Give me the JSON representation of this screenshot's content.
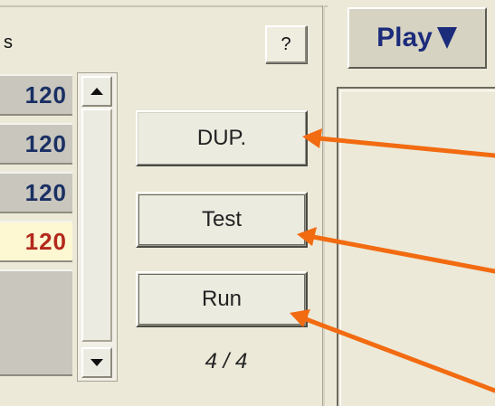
{
  "left_panel": {
    "header_text": "s",
    "help_label": "?",
    "list_rows": [
      {
        "text": "120",
        "selected": false
      },
      {
        "text": "120",
        "selected": false
      },
      {
        "text": "120",
        "selected": false
      },
      {
        "text": "120",
        "selected": true
      },
      {
        "text": "",
        "selected": false
      }
    ],
    "scroll_up_icon": "arrow-up",
    "scroll_down_icon": "arrow-down"
  },
  "actions": {
    "dup_label": "DUP.",
    "test_label": "Test",
    "run_label": "Run",
    "counter": "4 / 4"
  },
  "right_panel": {
    "play_label": "Play",
    "play_icon": "triangle-down"
  },
  "colors": {
    "accent_arrow": "#f26b11",
    "row_text": "#1a2f63",
    "selected_row_text": "#b3291b",
    "play_text": "#1c2c7b"
  }
}
